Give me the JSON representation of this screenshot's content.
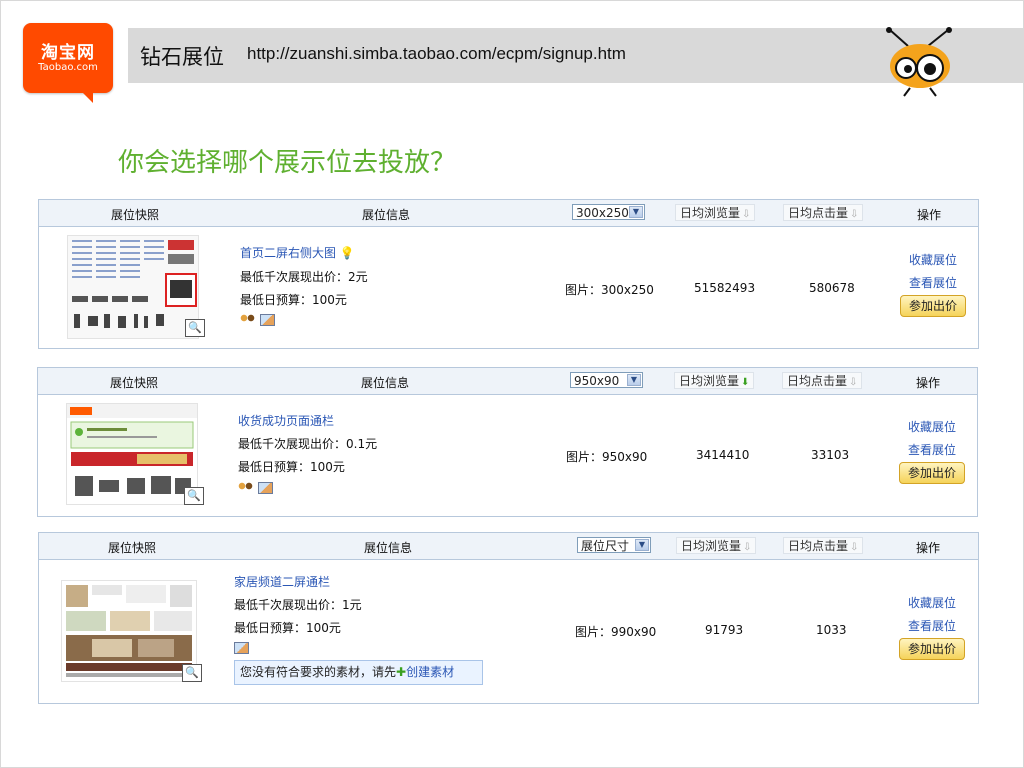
{
  "logo": {
    "cn": "淘宝网",
    "en": "Taobao.com"
  },
  "header": {
    "title": "钻石展位",
    "url": "http://zuanshi.simba.taobao.com/ecpm/signup.htm"
  },
  "question": "你会选择哪个展示位去投放？",
  "columns": {
    "snapshot": "展位快照",
    "info": "展位信息",
    "views": "日均浏览量",
    "clicks": "日均点击量",
    "action": "操作"
  },
  "panels": [
    {
      "size_select": "300x250",
      "views_sort_icon": "arrow-down-grey",
      "title": "首页二屏右侧大图",
      "title_icon": "lightbulb-icon",
      "min_cpm": "最低千次展现出价：2元",
      "daily_budget": "最低日预算：100元",
      "image": "图片：300x250",
      "views": "51582493",
      "clicks": "580678",
      "fav": "收藏展位",
      "view": "查看展位",
      "bid": "参加出价"
    },
    {
      "size_select": "950x90",
      "views_sort_icon": "arrow-down-green",
      "title": "收货成功页面通栏",
      "min_cpm": "最低千次展现出价：0.1元",
      "daily_budget": "最低日预算：100元",
      "image": "图片：950x90",
      "views": "3414410",
      "clicks": "33103",
      "fav": "收藏展位",
      "view": "查看展位",
      "bid": "参加出价"
    },
    {
      "size_select": "展位尺寸",
      "views_sort_icon": "arrow-down-grey",
      "title": "家居频道二屏通栏",
      "min_cpm": "最低千次展现出价：1元",
      "daily_budget": "最低日预算：100元",
      "image": "图片：990x90",
      "views": "91793",
      "clicks": "1033",
      "fav": "收藏展位",
      "view": "查看展位",
      "bid": "参加出价",
      "hint": "您没有符合要求的素材，请先",
      "hint_link": "创建素材"
    }
  ],
  "colors": {
    "question": "#5fb030",
    "link": "#2b57b5",
    "logo": "#ff4a00"
  }
}
